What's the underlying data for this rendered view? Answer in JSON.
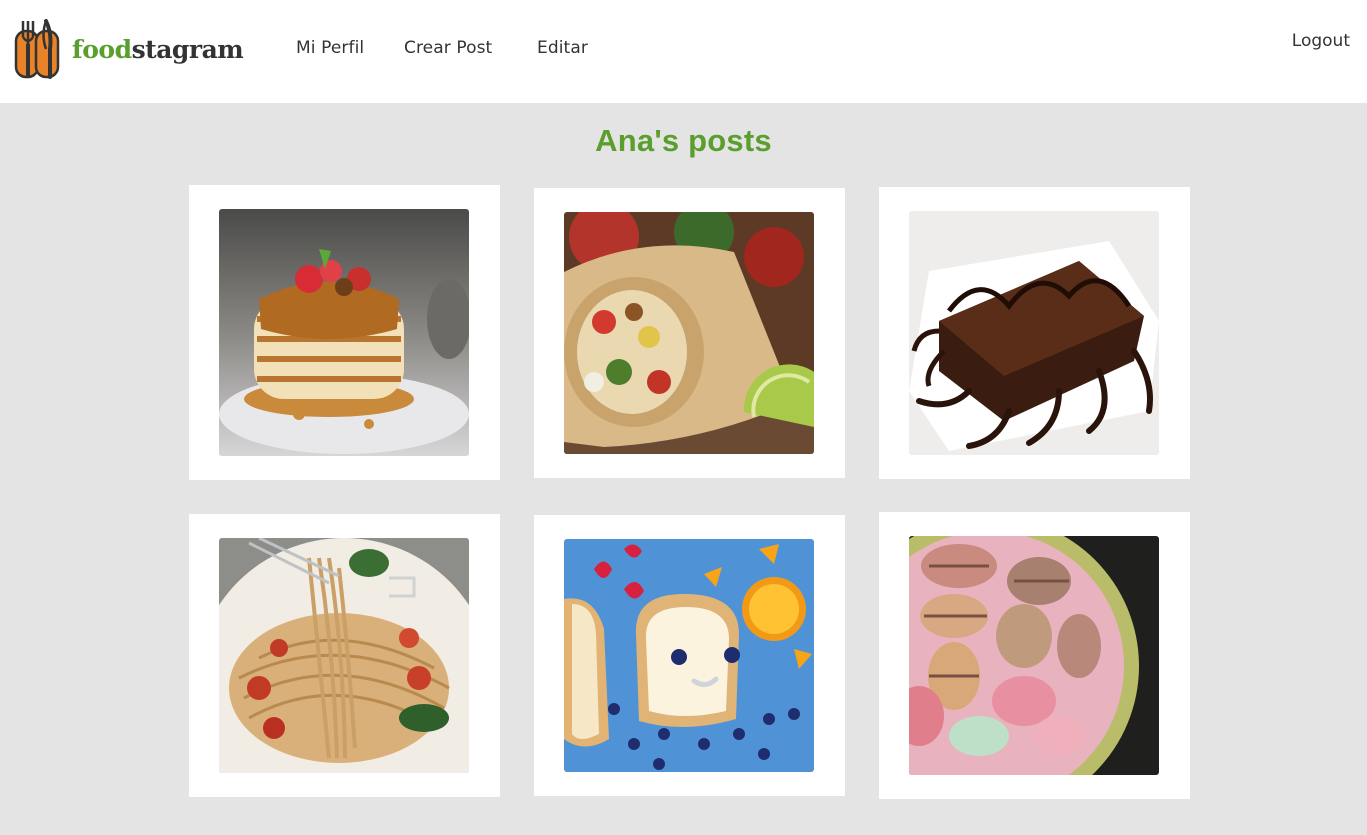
{
  "app": {
    "brand_left": "food",
    "brand_right": "stagram",
    "brand_color": "#5a9e2e",
    "accent_orange": "#e8832a"
  },
  "nav": {
    "perfil": "Mi Perfil",
    "crear": "Crear Post",
    "editar": "Editar",
    "logout": "Logout"
  },
  "page": {
    "title": "Ana's posts"
  },
  "posts": [
    {
      "photo": "pancakes-photo"
    },
    {
      "photo": "burrito-photo"
    },
    {
      "photo": "brownie-photo"
    },
    {
      "photo": "spaghetti-photo"
    },
    {
      "photo": "toast-smiley-photo"
    },
    {
      "photo": "macarons-photo"
    }
  ]
}
